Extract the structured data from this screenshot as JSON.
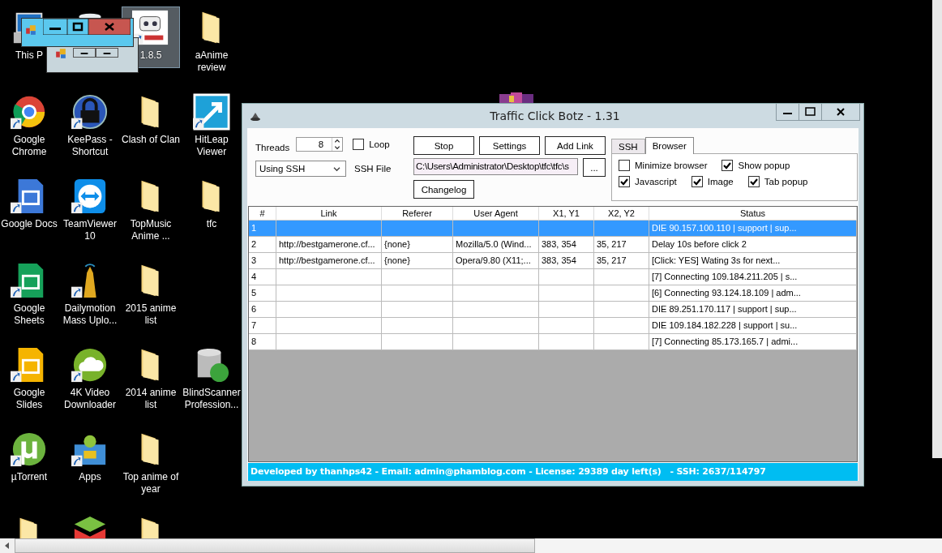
{
  "desktop": {
    "rows": [
      [
        {
          "kind": "pc",
          "label": "This P",
          "selected": false,
          "shortcut": false
        },
        {
          "kind": "bin",
          "selected": false
        },
        {
          "kind": "robot",
          "label": "1.8.5",
          "selected": true,
          "shortcut": true
        },
        {
          "kind": "folder",
          "label": "aAnime review",
          "selected": false,
          "shortcut": false
        }
      ],
      [
        {
          "kind": "chrome",
          "label": "Google Chrome",
          "selected": false,
          "shortcut": true
        },
        {
          "kind": "padlock",
          "label": "KeePass - Shortcut",
          "selected": false,
          "shortcut": true
        },
        {
          "kind": "folder",
          "label": "Clash of Clan",
          "selected": false,
          "shortcut": false
        },
        {
          "kind": "arrowtile",
          "label": "HitLeap Viewer",
          "selected": false,
          "shortcut": true
        }
      ],
      [
        {
          "kind": "doc",
          "label": "Google Docs",
          "selected": false,
          "shortcut": true
        },
        {
          "kind": "teamviewer",
          "label": "TeamViewer 10",
          "selected": false,
          "shortcut": true
        },
        {
          "kind": "folder",
          "label": "TopMusic Anime ...",
          "selected": false,
          "shortcut": false
        },
        {
          "kind": "folder",
          "label": "tfc",
          "selected": false,
          "shortcut": false
        }
      ],
      [
        {
          "kind": "sheet",
          "label": "Google Sheets",
          "selected": false,
          "shortcut": true
        },
        {
          "kind": "tower",
          "label": "Dailymotion Mass Uplo...",
          "selected": false,
          "shortcut": true
        },
        {
          "kind": "folder",
          "label": "2015 anime list",
          "selected": false,
          "shortcut": false
        }
      ],
      [
        {
          "kind": "slides",
          "label": "Google Slides",
          "selected": false,
          "shortcut": true
        },
        {
          "kind": "cloud",
          "label": "4K Video Downloader",
          "selected": false,
          "shortcut": true
        },
        {
          "kind": "folder",
          "label": "2014 anime list",
          "selected": false,
          "shortcut": false
        },
        {
          "kind": "database",
          "label": "BlindScanner Profession...",
          "selected": false,
          "shortcut": false
        }
      ],
      [
        {
          "kind": "torrent",
          "label": "µTorrent",
          "selected": false,
          "shortcut": true
        },
        {
          "kind": "apps",
          "label": "Apps",
          "selected": false,
          "shortcut": true
        },
        {
          "kind": "folder",
          "label": "Top anime of year",
          "selected": false,
          "shortcut": false
        }
      ],
      [
        {
          "kind": "drivefolder",
          "selected": false
        },
        {
          "kind": "stack",
          "selected": false
        },
        {
          "kind": "folder",
          "selected": false
        }
      ]
    ]
  },
  "window": {
    "title": "Traffic Click Botz - 1.31",
    "threads": {
      "label": "Threads",
      "value": "8"
    },
    "loop": {
      "label": "Loop",
      "checked": false
    },
    "mode": {
      "value": "Using SSH"
    },
    "ssh_file": {
      "label": "SSH File",
      "value": "C:\\Users\\Administrator\\Desktop\\tfc\\tfc\\s",
      "browse": "..."
    },
    "buttons": [
      "Stop",
      "Settings",
      "Add Link"
    ],
    "changelog": "Changelog",
    "tabs": [
      {
        "label": "SSH",
        "selected": false
      },
      {
        "label": "Browser",
        "selected": true
      }
    ],
    "options": [
      {
        "label": "Minimize browser",
        "checked": false
      },
      {
        "label": "Show popup",
        "checked": true
      },
      {
        "label": "Javascript",
        "checked": true
      },
      {
        "label": "Image",
        "checked": true
      },
      {
        "label": "Tab popup",
        "checked": true
      }
    ],
    "table": {
      "columns": [
        "#",
        "Link",
        "Referer",
        "User Agent",
        "X1, Y1",
        "X2, Y2",
        "Status"
      ],
      "rows": [
        {
          "selected": true,
          "number": "1",
          "status": "DIE 90.157.100.110 | support | sup..."
        },
        {
          "selected": false,
          "number": "2",
          "link": "http://bestgamerone.cf...",
          "referer": "{none}",
          "user_agent": "Mozilla/5.0 (Wind...",
          "x1_y1": "383, 354",
          "x2_y2": "35, 217",
          "status": "Delay 10s before click 2"
        },
        {
          "selected": false,
          "number": "3",
          "link": "http://bestgamerone.cf...",
          "referer": "{none}",
          "user_agent": "Opera/9.80 (X11;...",
          "x1_y1": "383, 354",
          "x2_y2": "35, 217",
          "status": "[Click: YES] Wating 3s for next..."
        },
        {
          "selected": false,
          "number": "4",
          "status": "[7] Connecting 109.184.211.205 | s..."
        },
        {
          "selected": false,
          "number": "5",
          "status": "[6] Connecting 93.124.18.109 | adm..."
        },
        {
          "selected": false,
          "number": "6",
          "status": "DIE 89.251.170.117 | support | sup..."
        },
        {
          "selected": false,
          "number": "7",
          "status": "DIE 109.184.182.228 | support | su..."
        },
        {
          "selected": false,
          "number": "8",
          "status": "[7] Connecting 85.173.165.7 | admi..."
        }
      ]
    },
    "status_bar": "Developed by thanhps42 - Email: admin@phamblog.com - License: 29389 day left(s)   - SSH: 2637/114797"
  }
}
